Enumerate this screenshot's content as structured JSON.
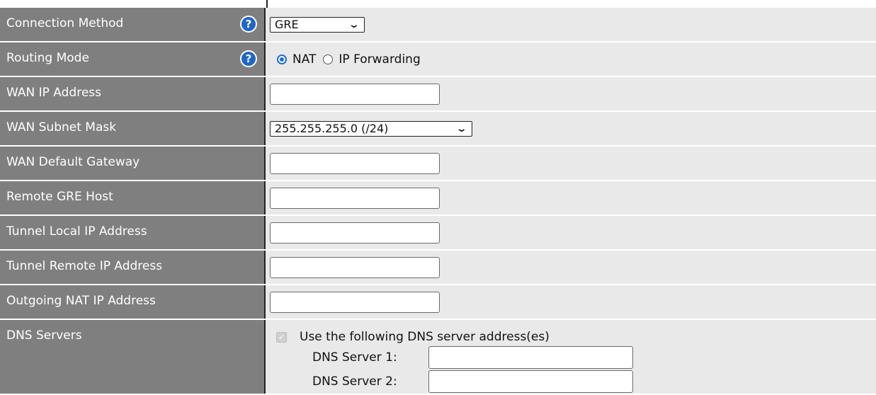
{
  "rows": {
    "connection_method": {
      "label": "Connection Method",
      "value": "GRE"
    },
    "routing_mode": {
      "label": "Routing Mode",
      "options": [
        "NAT",
        "IP Forwarding"
      ],
      "selected": "NAT"
    },
    "wan_ip": {
      "label": "WAN IP Address",
      "value": ""
    },
    "wan_subnet": {
      "label": "WAN Subnet Mask",
      "value": "255.255.255.0 (/24)"
    },
    "wan_gateway": {
      "label": "WAN Default Gateway",
      "value": ""
    },
    "remote_gre_host": {
      "label": "Remote GRE Host",
      "value": ""
    },
    "tunnel_local_ip": {
      "label": "Tunnel Local IP Address",
      "value": ""
    },
    "tunnel_remote_ip": {
      "label": "Tunnel Remote IP Address",
      "value": ""
    },
    "outgoing_nat_ip": {
      "label": "Outgoing NAT IP Address",
      "value": ""
    },
    "dns_servers": {
      "label": "DNS Servers",
      "checkbox_label": "Use the following DNS server address(es)",
      "checked": true,
      "server1_label": "DNS Server 1:",
      "server2_label": "DNS Server 2:",
      "server1_value": "",
      "server2_value": ""
    }
  },
  "help_glyph": "?",
  "icons": {
    "help": "help-circle-icon",
    "dropdown": "chevron-down-icon"
  },
  "colors": {
    "label_bg": "#7f7f7f",
    "value_bg": "#e9e9e9",
    "help_blue": "#1f66c9",
    "radio_blue": "#1a6fd6"
  }
}
